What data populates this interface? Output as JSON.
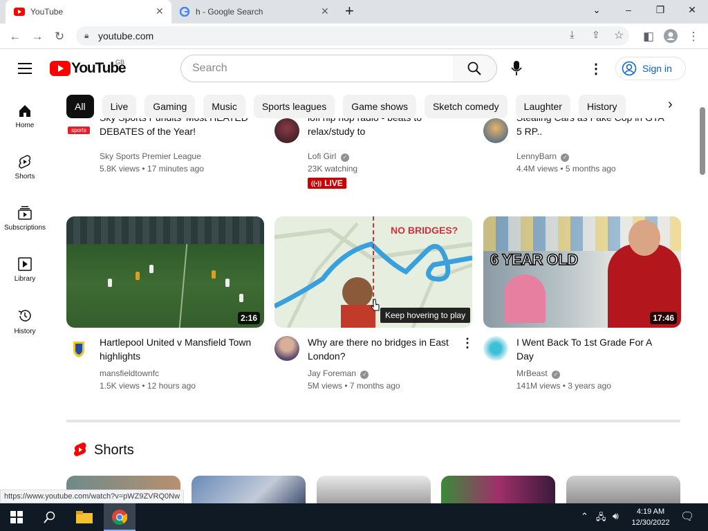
{
  "browser": {
    "tabs": [
      {
        "label": "YouTube",
        "active": true
      },
      {
        "label": "h - Google Search",
        "active": false
      }
    ],
    "url": "youtube.com",
    "status_url": "https://www.youtube.com/watch?v=pWZ9ZVRQ0Nw"
  },
  "header": {
    "logo": "YouTube",
    "region": "GB",
    "search_placeholder": "Search",
    "sign_in": "Sign in"
  },
  "chips": [
    "All",
    "Live",
    "Gaming",
    "Music",
    "Sports leagues",
    "Game shows",
    "Sketch comedy",
    "Laughter",
    "History"
  ],
  "sidebar": [
    {
      "label": "Home",
      "icon": "home-icon"
    },
    {
      "label": "Shorts",
      "icon": "shorts-icon"
    },
    {
      "label": "Subscriptions",
      "icon": "subscriptions-icon"
    },
    {
      "label": "Library",
      "icon": "library-icon"
    },
    {
      "label": "History",
      "icon": "history-icon"
    }
  ],
  "top_videos": [
    {
      "title_partial": "Sky Sports Pundits' Most HEATED",
      "title2": "DEBATES of the Year!",
      "channel": "Sky Sports Premier League",
      "meta": "5.8K views • 17 minutes ago",
      "avatar_text": "sports"
    },
    {
      "title_partial": "lofi hip hop radio - beats to",
      "title2": "relax/study to",
      "channel": "Lofi Girl",
      "meta": "23K watching",
      "live_badge": "LIVE"
    },
    {
      "title_partial": "Stealing Cars as Fake Cop in GTA",
      "title2": "5 RP..",
      "channel": "LennyBarn",
      "meta": "4.4M views • 5 months ago"
    }
  ],
  "videos": [
    {
      "title": "Hartlepool United v Mansfield Town highlights",
      "channel": "mansfieldtownfc",
      "meta": "1.5K views • 12 hours ago",
      "duration": "2:16"
    },
    {
      "title": "Why are there no bridges in East London?",
      "channel": "Jay Foreman",
      "meta": "5M views • 7 months ago",
      "overlay_text": "NO BRIDGES?",
      "hover_tooltip": "Keep hovering to play"
    },
    {
      "title": "I Went Back To 1st Grade For A Day",
      "channel": "MrBeast",
      "meta": "141M views • 3 years ago",
      "duration": "17:46",
      "overlay_text": "6 YEAR OLD"
    }
  ],
  "shorts_section": {
    "title": "Shorts"
  },
  "taskbar": {
    "time": "4:19 AM",
    "date": "12/30/2022"
  },
  "colors": {
    "yt_red": "#ff0000",
    "link_blue": "#065fd4",
    "taskbar": "#101a24"
  }
}
